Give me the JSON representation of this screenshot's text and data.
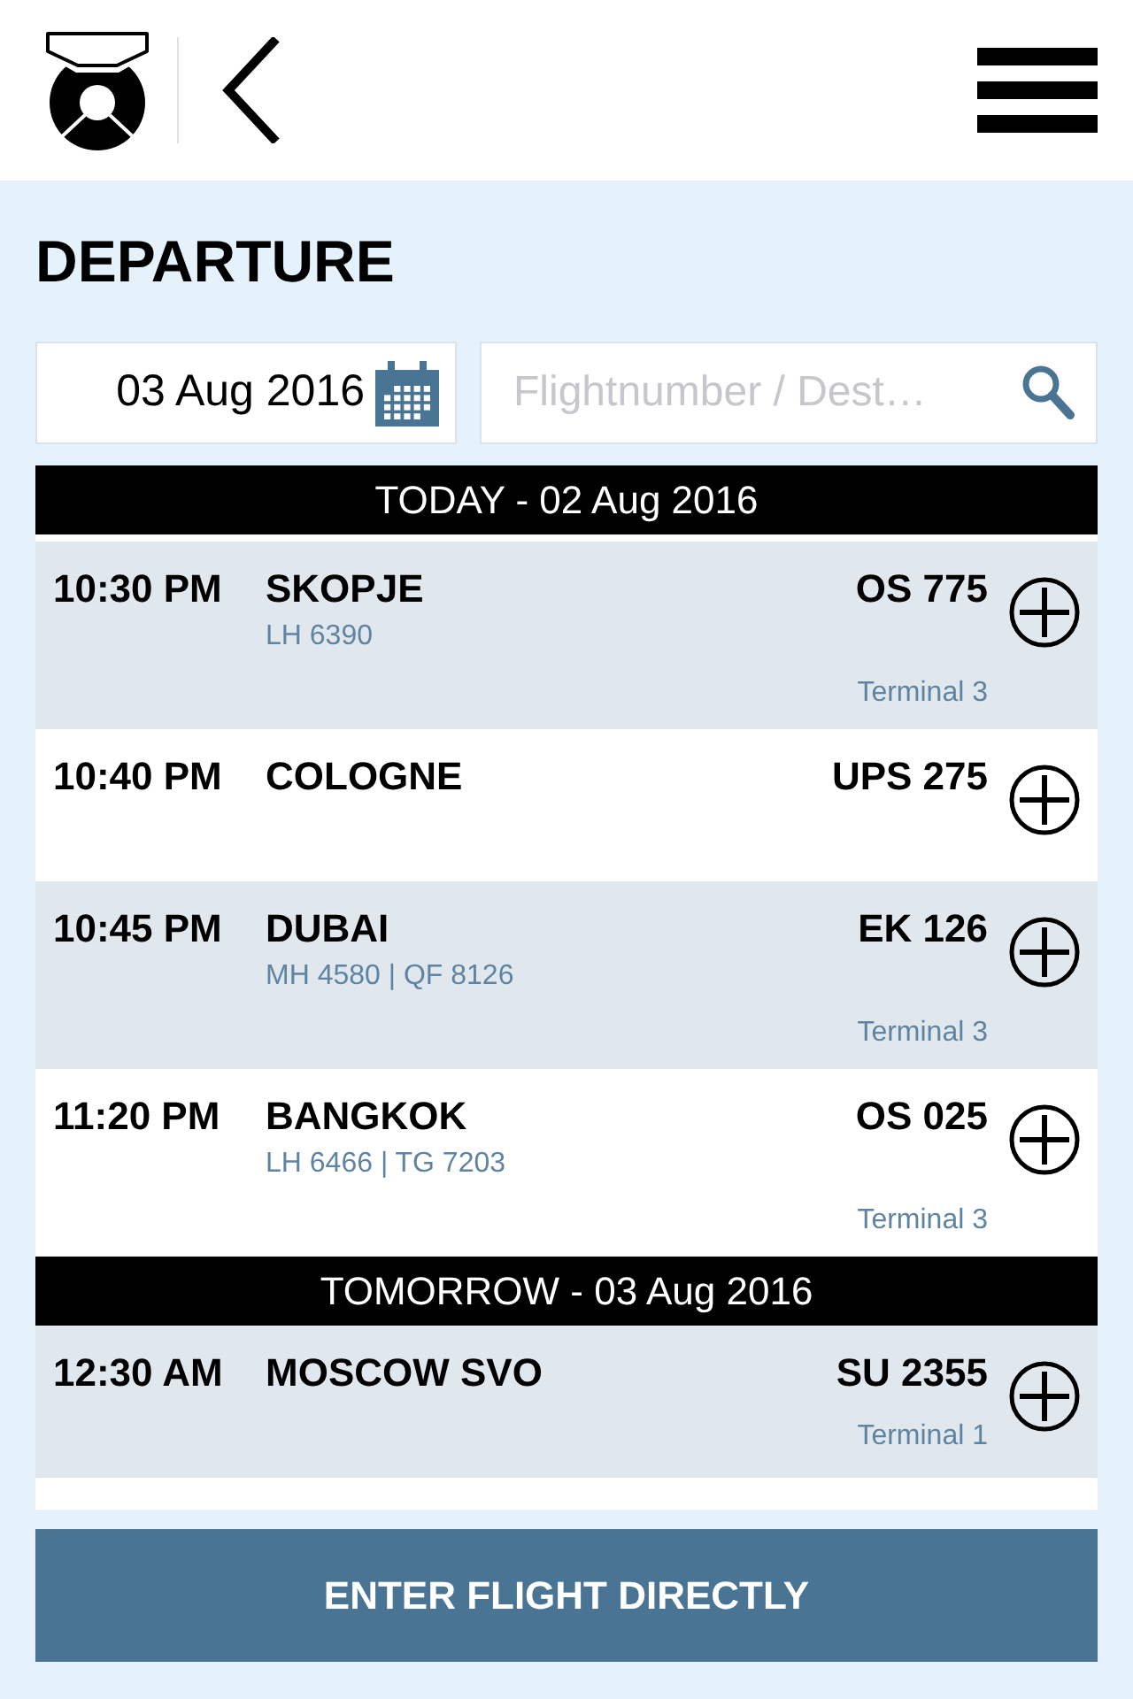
{
  "title": "DEPARTURE",
  "date_field": {
    "value": "03 Aug 2016"
  },
  "search": {
    "placeholder": "Flightnumber / Dest…"
  },
  "sections": [
    {
      "label": "TODAY - 02 Aug 2016",
      "flights": [
        {
          "time": "10:30 PM",
          "destination": "SKOPJE",
          "codeshares": "LH 6390",
          "flight": "OS 775",
          "terminal": "Terminal 3"
        },
        {
          "time": "10:40 PM",
          "destination": "COLOGNE",
          "flight": "UPS 275"
        },
        {
          "time": "10:45 PM",
          "destination": "DUBAI",
          "codeshares": "MH 4580 | QF 8126",
          "flight": "EK 126",
          "terminal": "Terminal 3"
        },
        {
          "time": "11:20 PM",
          "destination": "BANGKOK",
          "codeshares": "LH 6466 | TG 7203",
          "flight": "OS 025",
          "terminal": "Terminal 3"
        }
      ]
    },
    {
      "label": "TOMORROW - 03 Aug 2016",
      "flights": [
        {
          "time": "12:30 AM",
          "destination": "MOSCOW SVO",
          "flight": "SU 2355",
          "terminal": "Terminal 1"
        }
      ]
    }
  ],
  "button": {
    "label": "ENTER FLIGHT DIRECTLY"
  }
}
